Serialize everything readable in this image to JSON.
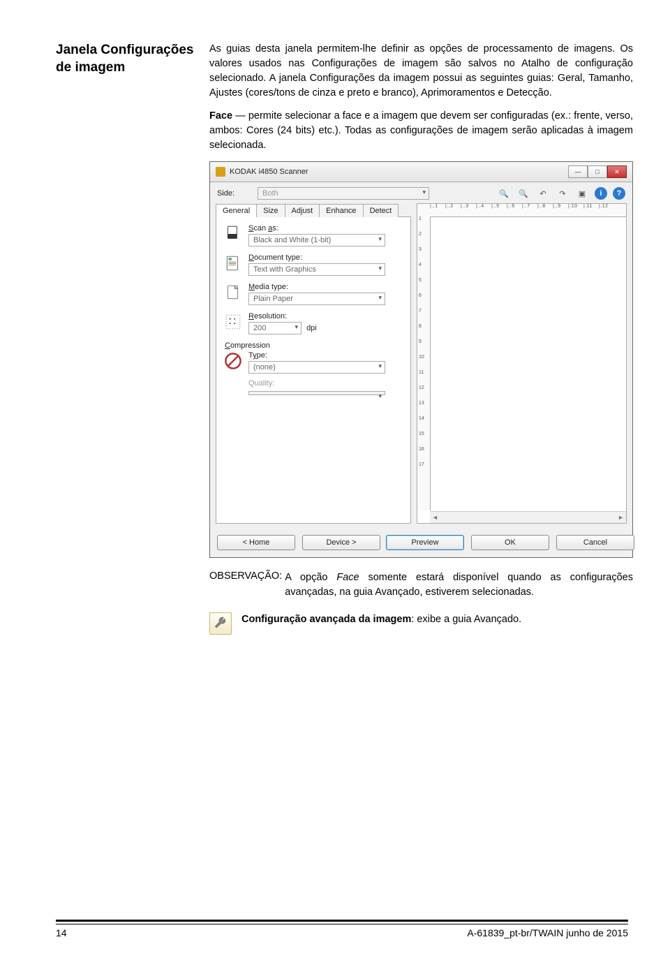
{
  "heading": "Janela Configurações de imagem",
  "para1": "As guias desta janela permitem-lhe definir as opções de processamento de imagens. Os valores usados nas Configurações de imagem são salvos no Atalho de configuração selecionado. A janela Configurações da imagem possui as seguintes guias: Geral, Tamanho, Ajustes (cores/tons de cinza e preto e branco), Aprimoramentos e Detecção.",
  "para2_lead": "Face",
  "para2_rest": " — permite selecionar a face e a imagem que devem ser configuradas (ex.: frente, verso, ambos: Cores (24 bits) etc.). Todas as configurações de imagem serão aplicadas à imagem selecionada.",
  "shot": {
    "title": "KODAK i4850 Scanner",
    "side_label": "Side:",
    "side_value": "Both",
    "tabs": {
      "general": "General",
      "size": "Size",
      "adjust": "Adjust",
      "enhance": "Enhance",
      "detect": "Detect"
    },
    "scan_as_label": "Scan as:",
    "scan_as_value": "Black and White (1-bit)",
    "doc_type_label": "Document type:",
    "doc_type_value": "Text with Graphics",
    "media_label": "Media type:",
    "media_value": "Plain Paper",
    "res_label": "Resolution:",
    "res_value": "200",
    "res_unit": "dpi",
    "comp_label": "Compression",
    "comp_type_label": "Type:",
    "comp_type_value": "(none)",
    "comp_quality_label": "Quality:",
    "comp_quality_value": "",
    "buttons": {
      "home": "< Home",
      "device": "Device >",
      "preview": "Preview",
      "ok": "OK",
      "cancel": "Cancel"
    }
  },
  "obs_label": "OBSERVAÇÃO:",
  "obs_text_a": "A opção ",
  "obs_text_b": "Face",
  "obs_text_c": " somente estará disponível quando as configurações avançadas, na guia Avançado, estiverem selecionadas.",
  "tool_lead": "Configuração avançada da imagem",
  "tool_rest": ": exibe a guia Avançado.",
  "footer_left": "14",
  "footer_right": "A-61839_pt-br/TWAIN  junho de 2015"
}
